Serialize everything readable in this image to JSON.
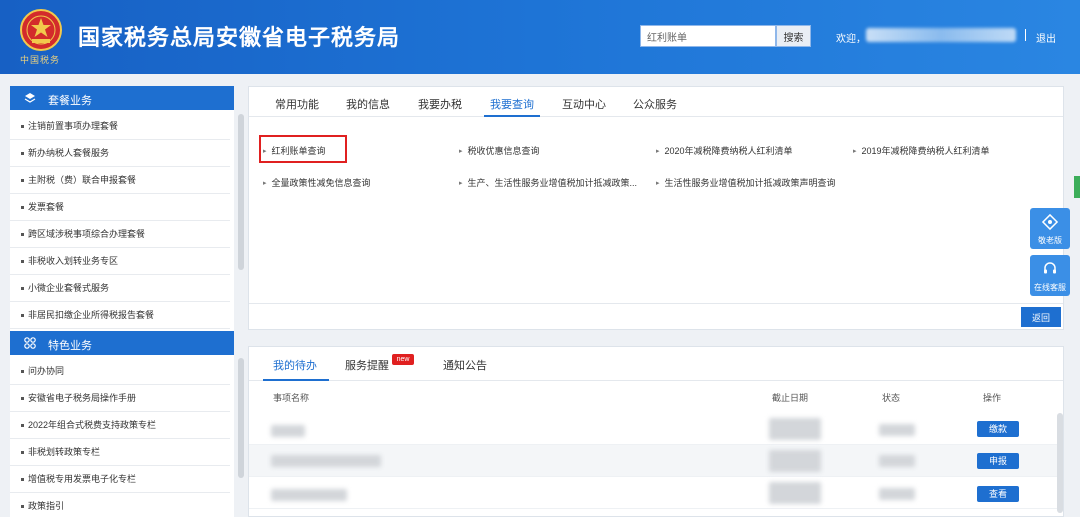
{
  "header": {
    "site_title": "国家税务总局安徽省电子税务局",
    "emblem_caption": "中国税务",
    "search_value": "红利账单",
    "search_button": "搜索",
    "welcome": "欢迎，",
    "logout": "退出"
  },
  "sidebar": {
    "section1": {
      "title": "套餐业务",
      "items": [
        "注销前置事项办理套餐",
        "新办纳税人套餐服务",
        "主附税（费）联合申报套餐",
        "发票套餐",
        "跨区域涉税事项综合办理套餐",
        "非税收入划转业务专区",
        "小微企业套餐式服务",
        "非居民扣缴企业所得税报告套餐"
      ]
    },
    "section2": {
      "title": "特色业务",
      "items": [
        "问办协同",
        "安徽省电子税务局操作手册",
        "2022年组合式税费支持政策专栏",
        "非税划转政策专栏",
        "增值税专用发票电子化专栏",
        "政策指引"
      ]
    }
  },
  "query_panel": {
    "tabs": [
      "常用功能",
      "我的信息",
      "我要办税",
      "我要查询",
      "互动中心",
      "公众服务"
    ],
    "active_tab": "我要查询",
    "items": [
      "红利账单查询",
      "税收优惠信息查询",
      "2020年减税降费纳税人红利清单",
      "2019年减税降费纳税人红利清单",
      "全量政策性减免信息查询",
      "生产、生活性服务业增值税加计抵减政策...",
      "生活性服务业增值税加计抵减政策声明查询"
    ],
    "back_button": "返回"
  },
  "floating": {
    "elder": "敬老版",
    "service": "在线客服"
  },
  "todo_panel": {
    "tabs": [
      "我的待办",
      "服务提醒",
      "通知公告"
    ],
    "new_badge": "new",
    "columns": [
      "事项名称",
      "截止日期",
      "状态",
      "操作"
    ],
    "rows": [
      {
        "action": "缴款"
      },
      {
        "action": "申报"
      },
      {
        "action": "查看"
      }
    ]
  },
  "colors": {
    "primary": "#1e6fd0",
    "header_gradient_start": "#1760c4",
    "highlight": "#e02020"
  }
}
